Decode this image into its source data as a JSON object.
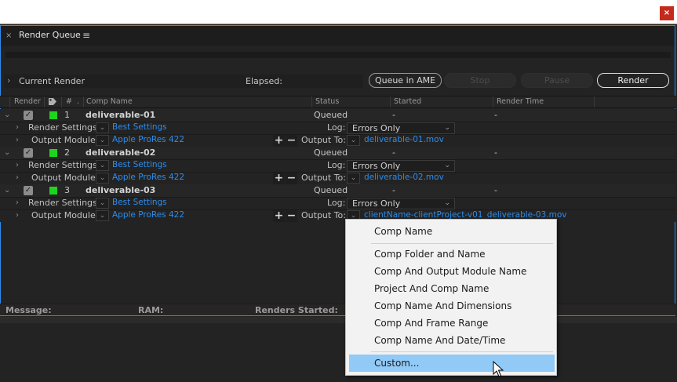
{
  "window": {
    "close_label": "×"
  },
  "panel": {
    "close_glyph": "×",
    "title": "Render Queue",
    "menu_glyph": "≡"
  },
  "current_render": {
    "label": "Current Render",
    "elapsed_label": "Elapsed:"
  },
  "buttons": {
    "queue_ame": "Queue in AME",
    "stop": "Stop",
    "pause": "Pause",
    "render": "Render"
  },
  "columns": {
    "render": "Render",
    "num": "#",
    "comp": "Comp Name",
    "status": "Status",
    "started": "Started",
    "render_time": "Render Time"
  },
  "items": [
    {
      "num": "1",
      "comp": "deliverable-01",
      "status": "Queued",
      "started": "-",
      "render_time": "-",
      "render_settings": "Best Settings",
      "log": "Errors Only",
      "output_module": "Apple ProRes 422",
      "output_to": "deliverable-01.mov"
    },
    {
      "num": "2",
      "comp": "deliverable-02",
      "status": "Queued",
      "started": "-",
      "render_time": "-",
      "render_settings": "Best Settings",
      "log": "Errors Only",
      "output_module": "Apple ProRes 422",
      "output_to": "deliverable-02.mov"
    },
    {
      "num": "3",
      "comp": "deliverable-03",
      "status": "Queued",
      "started": "-",
      "render_time": "-",
      "render_settings": "Best Settings",
      "log": "Errors Only",
      "output_module": "Apple ProRes 422",
      "output_to": "clientName-clientProject-v01_deliverable-03.mov"
    }
  ],
  "labels": {
    "render_settings": "Render Settings:",
    "output_module": "Output Module:",
    "log": "Log:",
    "output_to": "Output To:"
  },
  "footer": {
    "message": "Message:",
    "ram": "RAM:",
    "renders_started": "Renders Started:"
  },
  "menu": {
    "items": [
      "Comp Name",
      "Comp Folder and Name",
      "Comp And Output Module Name",
      "Project And Comp Name",
      "Comp Name And Dimensions",
      "Comp And Frame Range",
      "Comp Name And Date/Time",
      "Custom..."
    ],
    "selected": "Custom..."
  },
  "colors": {
    "accent": "#2d8ceb",
    "label_swatch": "#1ed41e",
    "menu_highlight": "#91c9f7"
  }
}
